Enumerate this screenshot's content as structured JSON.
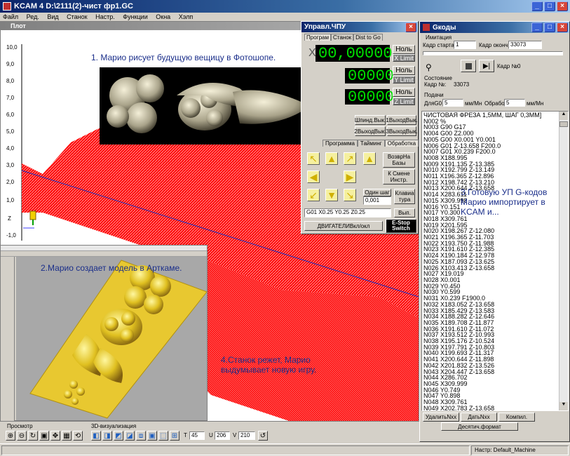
{
  "window": {
    "title": "KCAM 4  D:\\2111(2)-чист фр1.GC"
  },
  "menu": [
    "Файл",
    "Ред.",
    "Вид",
    "Станок",
    "Настр.",
    "Функции",
    "Окна",
    "Хэлп"
  ],
  "plot": {
    "title": "Плот",
    "yticks": [
      "10,0",
      "9,0",
      "8,0",
      "7,0",
      "6,0",
      "5,0",
      "4,0",
      "3,0",
      "2,0",
      "1,0",
      "Z",
      "-1,0"
    ],
    "axis_z": "Z"
  },
  "cnc": {
    "title": "Управл.ЧПУ",
    "tabs": [
      "Програм",
      "Станок",
      "Dist to Go"
    ],
    "x_label": "X",
    "x_value": "00,000000",
    "y_value": "00000",
    "z_value": "00000",
    "zero_label": "Ноль",
    "x_limit": "X Limit",
    "y_limit": "Y Limit",
    "z_limit": "Z Limit",
    "spindle": "Шпинд.Вык.",
    "out1": "1ВыходВык.",
    "out2": "2ВыходВык.",
    "out3": "3ВыходВык.",
    "subtabs": [
      "Программа",
      "Тайминг",
      "Обработка"
    ],
    "return_home": "ВозврНа Базы",
    "tool_change": "К Смене Инстр.",
    "one_step": "Один шаг",
    "step_value": "0,001",
    "keyboard": "Клавиа тура",
    "gcode_cmd": "G01 X0.25 Y0.25 Z0.25",
    "run": "Вып.",
    "motors": "ДВИГАТЕЛИВкл/окл",
    "estop": "E-Stop Switch"
  },
  "gcodes": {
    "title": "Gкоды",
    "imitation": "Имитация",
    "start_label": "Кадр старта:",
    "start_value": "1",
    "end_label": "Кадр оконч.:",
    "end_value": "33073",
    "frame": "Кадр №0",
    "status_title": "Состояние",
    "frame_no_label": "Кадр №:",
    "frame_no_value": "33073",
    "feed_title": "Подачи",
    "g0_label": "ДляG0",
    "g0_value": "5",
    "g0_unit": "мм/Мн",
    "work_label": "Обработ",
    "work_value": "5",
    "work_unit": "мм/Мн",
    "lines": [
      "ЧИСТОВАЯ ФРЕЗА 1,5ММ, ШАГ 0,3ММ]",
      "N002 %",
      "N003 G90 G17",
      "N004 G00 Z2.000",
      "N005 G00 X0.001 Y0.001",
      "N006 G01   Z-13.658 F200.0",
      "N007 G01 X0.239  F200.0",
      "N008 X188.995",
      "N009 X191.135 Z-13.385",
      "N010 X192.799 Z-13.149",
      "N011 X196.365 Z-12.896",
      "N012 X198.742 Z-13.210",
      "N013 X200.644 Z-13.658",
      "N014 X283.611",
      "N015 X309.998",
      "N016 Y0.151",
      "N017 Y0.300",
      "N018 X309.761",
      "N019 X201.595",
      "N020 X198.267 Z-12.080",
      "N021 X196.365 Z-11.703",
      "N022 X193.750 Z-11.988",
      "N023 X191.610 Z-12.385",
      "N024 X190.184 Z-12.978",
      "N025 X187.093 Z-13.625",
      "N026 X103.413 Z-13.658",
      "N027 X19.019",
      "N028 X0.001",
      "N029 Y0.450",
      "N030 Y0.599",
      "N031 X0.239 F1900.0",
      "N032 X183.052 Z-13.658",
      "N033 X185.429 Z-13.583",
      "N034 X188.282 Z-12.646",
      "N035 X189.708 Z-11.877",
      "N036 X191.610 Z-11.072",
      "N037 X193.512 Z-10.993",
      "N038 X195.176 Z-10.524",
      "N039 X197.791 Z-10.803",
      "N040 X199.693 Z-11.317",
      "N041 X200.644 Z-11.898",
      "N042 X201.832 Z-13.526",
      "N043 X204.447 Z-13.658",
      "N044 X286.702",
      "N045 X309.999",
      "N046 Y0.749",
      "N047 Y0.898",
      "N048 X309.761",
      "N049 X202.783 Z-13.658",
      "N050 X202.308 Z-13.642",
      "N051 X201.595 Z-12.389"
    ],
    "btn_delete": "УдалитьNхх",
    "btn_give": "ДатьNхх",
    "btn_compile": "Компил.",
    "btn_decimal": "Десятич.формат"
  },
  "bottom": {
    "tab_view": "Просмотр",
    "tab_3d": "3D-визуализация",
    "t_label": "T",
    "t_value": "45",
    "u_label": "U",
    "u_value": "206",
    "v_label": "V",
    "v_value": "210"
  },
  "status": {
    "machine": "Настр: Default_Machine"
  },
  "captions": {
    "c1": "1. Марио рисует будущую вещицу в Фотошопе.",
    "c2": "2.Марио создает модель в Арткаме.",
    "c3": "3.Готовую УП G-кодов Марио импортирует в KCAM и...",
    "c4": "4.Станок режет, Марио выдумывает новую игру."
  }
}
